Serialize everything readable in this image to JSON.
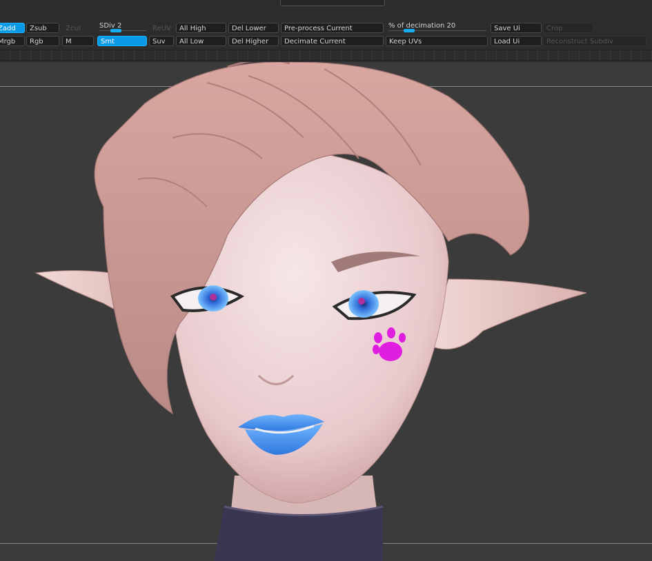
{
  "toolbar": {
    "row1": {
      "zadd": "Zadd",
      "zsub": "Zsub",
      "zcut": "Zcut",
      "sdiv_label": "SDiv",
      "sdiv_value": "2",
      "reuv": "ReUV",
      "all_high": "All High",
      "del_lower": "Del Lower",
      "preprocess_current": "Pre-process Current",
      "decimation_label": "% of decimation",
      "decimation_value": "20",
      "save_ui": "Save Ui",
      "crop": "Crop"
    },
    "row2": {
      "mrgb": "Mrgb",
      "rgb": "Rgb",
      "m": "M",
      "smt": "Smt",
      "suv": "Suv",
      "all_low": "All Low",
      "del_higher": "Del Higher",
      "decimate_current": "Decimate Current",
      "keep_uvs": "Keep UVs",
      "load_ui": "Load Ui",
      "reconstruct_subdiv": "Reconstruct Subdiv"
    },
    "colors": {
      "active": "#0a99e6",
      "background": "#2c2c2c"
    }
  },
  "viewport": {
    "content": "sculpted elf head",
    "paw_color": "#e01ee0",
    "lip_color": "#4a9af0"
  }
}
